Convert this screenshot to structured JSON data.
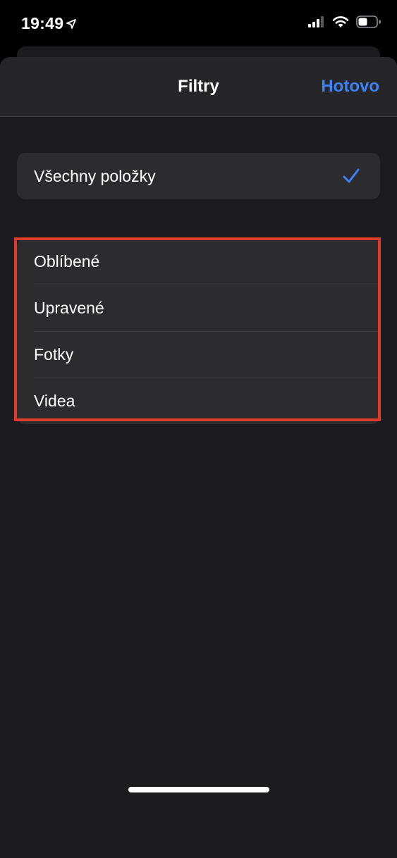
{
  "status_bar": {
    "time": "19:49",
    "icons": [
      "location-arrow-icon",
      "cellular-signal-icon",
      "wifi-icon",
      "battery-icon"
    ]
  },
  "sheet": {
    "title": "Filtry",
    "done_label": "Hotovo",
    "all_items": {
      "label": "Všechny položky",
      "selected": true
    },
    "filters": [
      {
        "label": "Oblíbené"
      },
      {
        "label": "Upravené"
      },
      {
        "label": "Fotky"
      },
      {
        "label": "Videa"
      }
    ]
  },
  "colors": {
    "accent": "#3d82f6",
    "sheet_background": "#1c1c1e",
    "row_background": "#2c2c2e",
    "highlight_border": "#e03a2a"
  }
}
